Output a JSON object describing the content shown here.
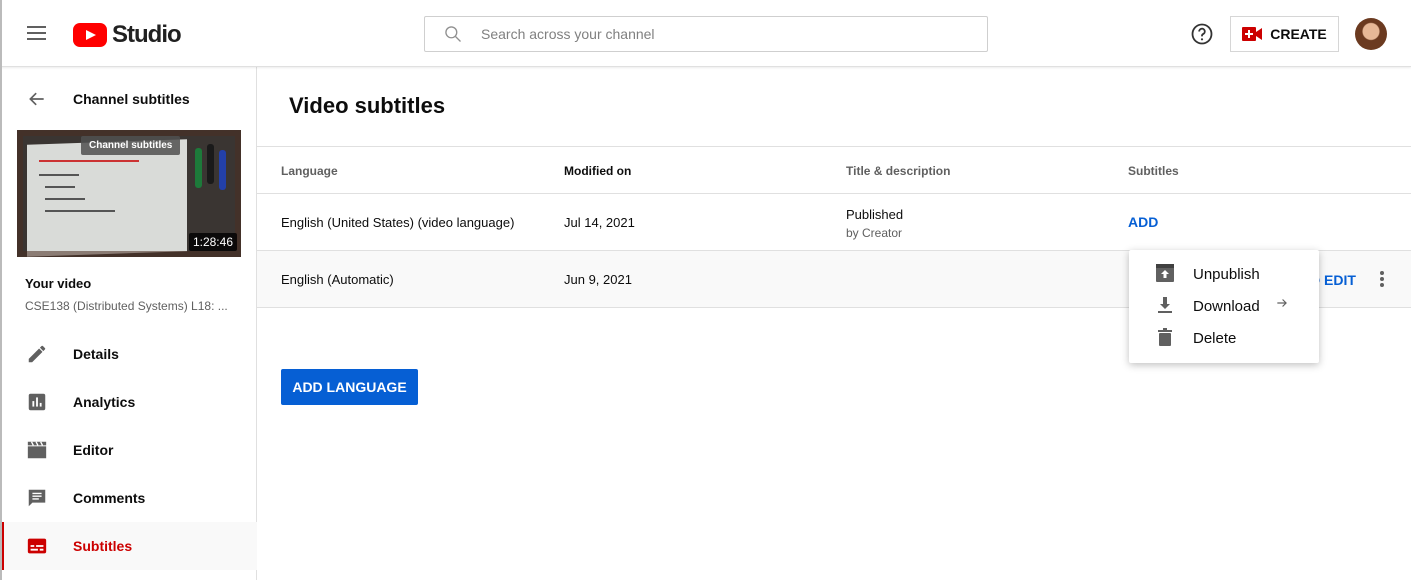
{
  "header": {
    "app_name": "Studio",
    "search_placeholder": "Search across your channel",
    "create_label": "CREATE"
  },
  "sidebar": {
    "back_title": "Channel subtitles",
    "thumbnail": {
      "badge": "Channel subtitles",
      "duration": "1:28:46"
    },
    "your_video_label": "Your video",
    "video_title": "CSE138 (Distributed Systems) L18: ...",
    "items": [
      {
        "label": "Details",
        "icon": "pencil-icon",
        "active": false
      },
      {
        "label": "Analytics",
        "icon": "analytics-icon",
        "active": false
      },
      {
        "label": "Editor",
        "icon": "clapperboard-icon",
        "active": false
      },
      {
        "label": "Comments",
        "icon": "comment-icon",
        "active": false
      },
      {
        "label": "Subtitles",
        "icon": "subtitles-icon",
        "active": true
      }
    ]
  },
  "main": {
    "title": "Video subtitles",
    "columns": [
      "Language",
      "Modified on",
      "Title & description",
      "Subtitles"
    ],
    "rows": [
      {
        "language": "English (United States) (video language)",
        "modified": "Jul 14, 2021",
        "title_desc": "Published",
        "title_desc_sub": "by Creator",
        "subtitles_action": "ADD"
      },
      {
        "language": "English (Automatic)",
        "modified": "Jun 9, 2021",
        "title_desc": "",
        "title_desc_sub": "",
        "subtitles_action": "DUPLICATE AND EDIT",
        "subtitles_action_visible": "D EDIT"
      }
    ],
    "add_language_label": "ADD LANGUAGE"
  },
  "context_menu": {
    "items": [
      {
        "label": "Unpublish",
        "icon": "unpublish-icon"
      },
      {
        "label": "Download",
        "icon": "download-icon",
        "submenu": true
      },
      {
        "label": "Delete",
        "icon": "trash-icon"
      }
    ]
  },
  "colors": {
    "brand_red": "#ff0000",
    "active_red": "#cc0000",
    "link_blue": "#065fd4"
  }
}
